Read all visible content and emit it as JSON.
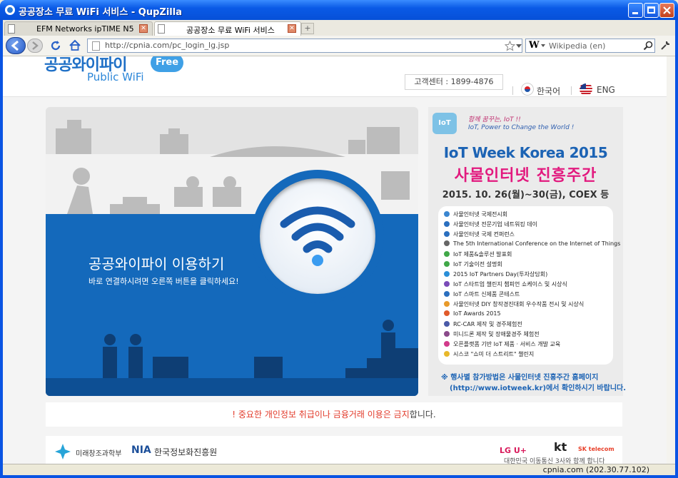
{
  "window": {
    "title": "공공장소 무료 WiFi 서비스 - QupZilla"
  },
  "tabs": [
    {
      "label": "EFM Networks ipTIME N5",
      "active": false
    },
    {
      "label": "공공장소 무료 WiFi 서비스",
      "active": true
    }
  ],
  "nav": {
    "url": "http://cpnia.com/pc_login_lg.jsp",
    "search_engine": "W",
    "search_placeholder": "Wikipedia (en)"
  },
  "header": {
    "logo_kr": "공공와이파이",
    "logo_en": "Public WiFi",
    "logo_badge": "Free",
    "customer_center": "고객센터 : 1899-4876",
    "lang_kr": "한국어",
    "lang_en": "ENG"
  },
  "hero": {
    "title": "공공와이파이 이용하기",
    "subtitle": "바로 연결하시려면 오른쪽 버튼을 클릭하세요!"
  },
  "iot": {
    "badge": "IoT",
    "tagline1": "함께 꿈꾸는, IoT !!",
    "tagline2": "IoT, Power to Change the World !",
    "title_en": "IoT Week Korea 2015",
    "title_kr": "사물인터넷 진흥주간",
    "dates": "2015. 10. 26(월)~30(금), COEX 등",
    "items": [
      "사물인터넷 국제전시회",
      "사물인터넷 전문기업 네트워킹 데이",
      "사물인터넷 국제 컨퍼런스",
      "The 5th International Conference on the Internet of Things",
      "IoT 제품&솔루션 발표회",
      "IoT 기술이전 설명회",
      "2015 IoT Partners Day(투자상담회)",
      "IoT 스타트업 챌린지 챔피언 쇼케이스 및 시상식",
      "IoT 스마트 신제품 콘테스트",
      "사물인터넷 DIY 창작경진대회 우수작품 전시 및 시상식",
      "IoT Awards 2015",
      "RC-CAR 제작 및 경주체험전",
      "미니드론 제작 및 장애물경주 체험전",
      "오픈플랫폼 기반 IoT 제품 · 서비스 개발 교육",
      "시스코 \"쇼미 더 스트리트\" 챌린지"
    ],
    "note1": "※ 행사별 참가방법은 사물인터넷 진흥주간 홈페이지",
    "note2": "(http://www.iotweek.kr)에서 확인하시기 바랍니다."
  },
  "notice": {
    "prefix": "! 중요한 ",
    "highlight": "개인정보 취급이나 금융거래 이용은 금지",
    "suffix": "합니다."
  },
  "footer": {
    "ministry": "미래창조과학부",
    "nia_abbr": "NIA",
    "nia_name": "한국정보화진흥원",
    "partner1": "LG U+",
    "partner2": "kt",
    "partner3": "SK telecom",
    "partner_caption": "대한민국 이동통신 3사와 함께 합니다"
  },
  "status": {
    "text": "cpnia.com (202.30.77.102)"
  },
  "colors": {
    "brand_blue": "#1469bb",
    "iot_pink": "#e2197e",
    "notice_red": "#e23a2a"
  }
}
